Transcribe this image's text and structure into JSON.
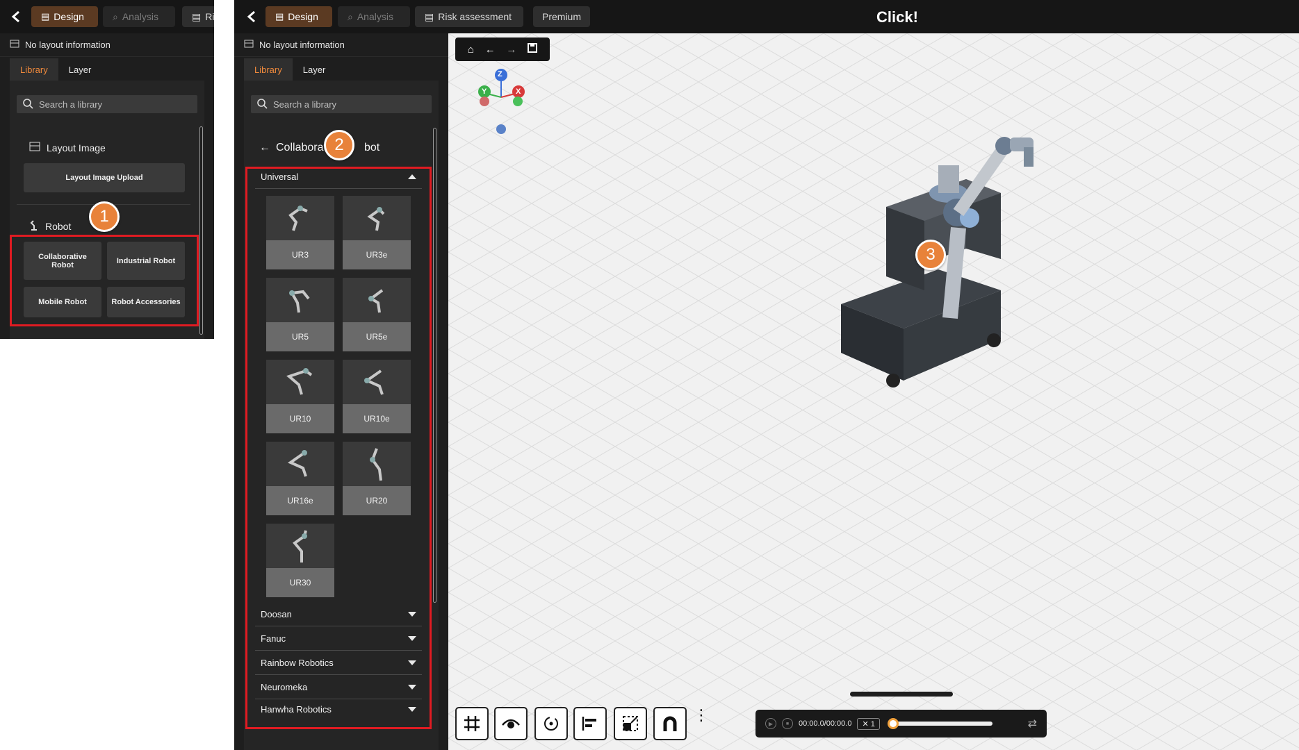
{
  "left_panel": {
    "tabs": {
      "design": "Design",
      "analysis": "Analysis",
      "risk": "Ri"
    },
    "layout_info": "No layout information",
    "subtabs": {
      "library": "Library",
      "layer": "Layer"
    },
    "search_placeholder": "Search a library",
    "layout_image": {
      "title": "Layout Image",
      "upload_button": "Layout Image Upload"
    },
    "robot": {
      "title": "Robot",
      "buttons": [
        "Collaborative Robot",
        "Industrial Robot",
        "Mobile Robot",
        "Robot Accessories"
      ]
    },
    "badge": "1"
  },
  "topbar": {
    "tabs": {
      "design": "Design",
      "analysis": "Analysis",
      "risk": "Risk assessment",
      "premium": "Premium"
    },
    "logo": "Click!"
  },
  "sidebar": {
    "layout_info": "No layout information",
    "subtabs": {
      "library": "Library",
      "layer": "Layer"
    },
    "search_placeholder": "Search a library",
    "back_title_left": "Collaborat",
    "back_title_right": "bot",
    "badge": "2",
    "expanded_brand": "Universal",
    "robots": [
      "UR3",
      "UR3e",
      "UR5",
      "UR5e",
      "UR10",
      "UR10e",
      "UR16e",
      "UR20",
      "UR30"
    ],
    "collapsed_brands": [
      "Doosan",
      "Fanuc",
      "Rainbow Robotics",
      "Neuromeka",
      "Hanwha Robotics"
    ]
  },
  "viewport": {
    "badge": "3",
    "axes": {
      "z": "Z",
      "y": "Y",
      "x": "X"
    },
    "timeline": {
      "time": "00:00.0/00:00.0",
      "speed": "✕ 1",
      "progress": 0.0
    }
  },
  "colors": {
    "accent": "#f08a3c",
    "highlight": "#e01b22",
    "badge": "#e8823a"
  }
}
